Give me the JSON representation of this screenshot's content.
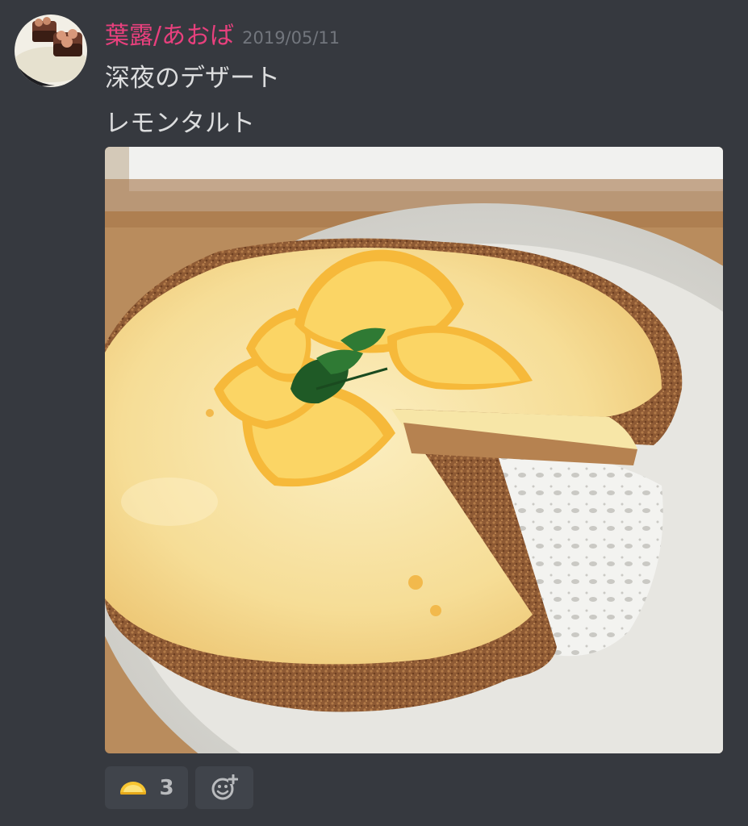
{
  "message": {
    "author": "葉露/あおば",
    "timestamp": "2019/05/11",
    "lines": [
      "深夜のデザート",
      "レモンタルト"
    ]
  },
  "attachment": {
    "kind": "photo",
    "subject": "lemon tart"
  },
  "reactions": [
    {
      "icon": "lemon-icon",
      "count": "3"
    }
  ],
  "add_reaction_icon": "add-reaction-icon",
  "colors": {
    "background": "#36393f",
    "username": "#e8407d",
    "timestamp": "#72767d",
    "text": "#dcddde",
    "reaction_bg": "#40444b"
  }
}
